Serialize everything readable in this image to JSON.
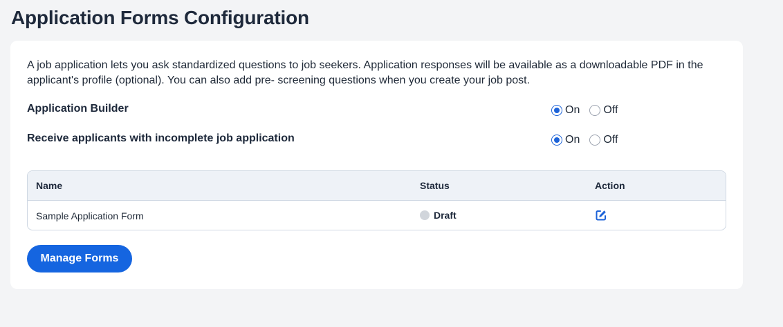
{
  "page": {
    "title": "Application Forms Configuration"
  },
  "intro": "A job application lets you ask standardized questions to job seekers. Application responses will be available as a downloadable PDF in the applicant's profile (optional). You can also add pre- screening questions when you create your job post.",
  "settings": [
    {
      "label": "Application Builder",
      "on_label": "On",
      "off_label": "Off",
      "value": "On"
    },
    {
      "label": "Receive applicants with incomplete job application",
      "on_label": "On",
      "off_label": "Off",
      "value": "On"
    }
  ],
  "table": {
    "headers": {
      "name": "Name",
      "status": "Status",
      "action": "Action"
    },
    "rows": [
      {
        "name": "Sample Application Form",
        "status": "Draft",
        "action_icon": "edit-icon"
      }
    ]
  },
  "buttons": {
    "manage_forms": "Manage Forms"
  },
  "colors": {
    "accent": "#1565e0",
    "radio": "#1d63d8",
    "status_draft": "#d1d5db"
  }
}
